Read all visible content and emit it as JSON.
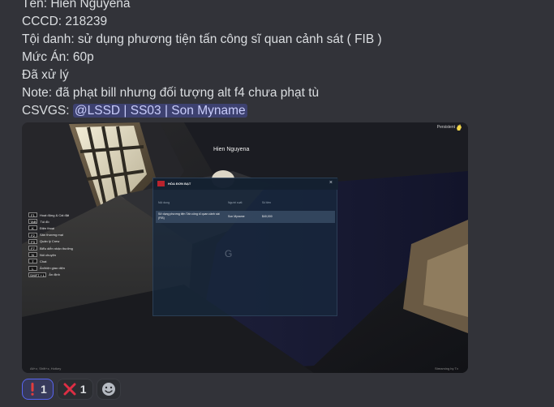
{
  "message": {
    "lines": [
      "Tên: Hien Nguyena",
      "CCCD: 218239",
      "Tội danh: sử dụng phương tiện tấn công sĩ quan cảnh sát ( FIB )",
      "Mức Án: 60p",
      "Đã xử lý",
      "Note: đã phạt bill nhưng đối tượng alt f4 chưa phạt tù"
    ],
    "csvgs_label": "CSVGS:",
    "mention": "@LSSD | SS03 | Son Myname"
  },
  "attachment": {
    "nametag": "Hien Nguyena",
    "topright_text": "Persistent",
    "keybinds": [
      {
        "key": "F1",
        "label": "Hoạt động & Cài đặt"
      },
      {
        "key": "TAB",
        "label": "Túi đồ"
      },
      {
        "key": "K",
        "label": "Điện thoại"
      },
      {
        "key": "F2",
        "label": "Sân thương mại"
      },
      {
        "key": "F3",
        "label": "Quản lý Crew"
      },
      {
        "key": "F7",
        "label": "Biểu diễn nhận thưởng"
      },
      {
        "key": "N",
        "label": "Nói chuyện"
      },
      {
        "key": "T",
        "label": "Chat"
      },
      {
        "key": "L",
        "label": "Ẩn/hiện giao diện"
      },
      {
        "key": "SHIFT + L",
        "label": "Ẩn định"
      }
    ],
    "bill_panel": {
      "title": "HÓA ĐƠN BẠT",
      "close": "×",
      "columns": [
        "Nội dung",
        "Người xuất",
        "Số tiền"
      ],
      "row": {
        "content": "Sử dụng phương tiện Tấn công sĩ quan cảnh sát (FIB)",
        "issuer": "Son Myname",
        "amount": "$40,000"
      },
      "placeholder_glyph": "G"
    },
    "watermark_left": "Alt+z, Shift+z, Hotkey",
    "watermark_right": "Streaming by Tv"
  },
  "reactions": [
    {
      "emoji": "exclamation-icon",
      "count": "1",
      "active": true
    },
    {
      "emoji": "cross-mark-icon",
      "count": "1",
      "active": false
    }
  ],
  "colors": {
    "background": "#323339",
    "mention_bg": "#3c4270",
    "mention_text": "#c9cdfb",
    "reaction_active_border": "#5865f2",
    "exclamation_red": "#e23d3d",
    "cross_red": "#dd2e44"
  }
}
